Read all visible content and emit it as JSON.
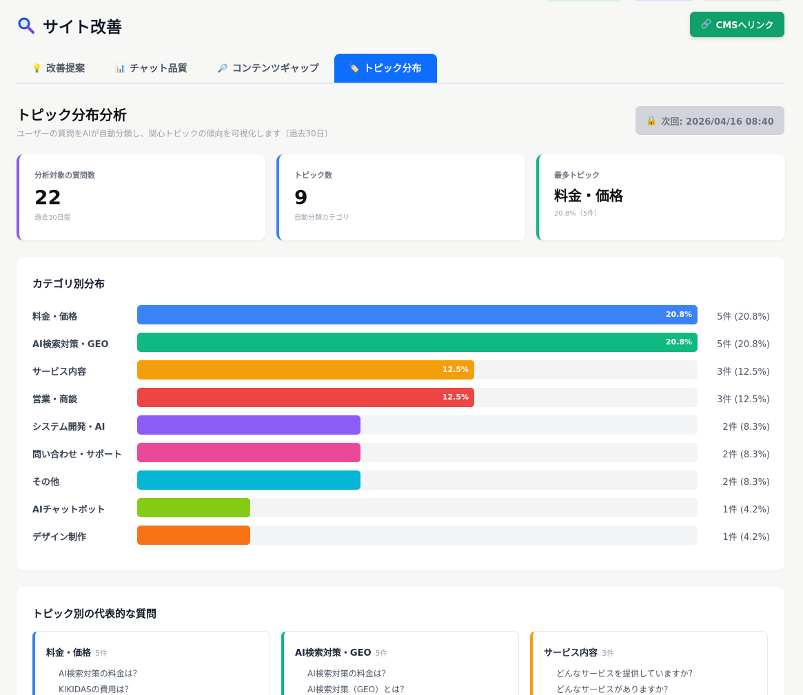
{
  "header": {
    "title": "サイト改善",
    "cms_button": "CMSへリンク"
  },
  "tabs": [
    {
      "icon": "💡",
      "label": "改善提案"
    },
    {
      "icon": "📊",
      "label": "チャット品質"
    },
    {
      "icon": "🔎",
      "label": "コンテンツギャップ"
    },
    {
      "icon": "🏷️",
      "label": "トピック分布"
    }
  ],
  "section": {
    "title": "トピック分布分析",
    "subtitle": "ユーザーの質問をAIが自動分類し、関心トピックの傾向を可視化します（過去30日）",
    "next_run": "次回: 2026/04/16 08:40"
  },
  "stats": [
    {
      "label": "分析対象の質問数",
      "value": "22",
      "note": "過去30日間"
    },
    {
      "label": "トピック数",
      "value": "9",
      "note": "自動分類カテゴリ"
    },
    {
      "label": "最多トピック",
      "value": "料金・価格",
      "note": "20.8%（5件）"
    }
  ],
  "chart_data": {
    "type": "bar",
    "title": "カテゴリ別分布",
    "categories": [
      "料金・価格",
      "AI検索対策・GEO",
      "サービス内容",
      "営業・商談",
      "システム開発・AI",
      "問い合わせ・サポート",
      "その他",
      "AIチャットボット",
      "デザイン制作"
    ],
    "values": [
      20.8,
      20.8,
      12.5,
      12.5,
      8.3,
      8.3,
      8.3,
      4.2,
      4.2
    ],
    "counts": [
      "5件 (20.8%)",
      "5件 (20.8%)",
      "3件 (12.5%)",
      "3件 (12.5%)",
      "2件 (8.3%)",
      "2件 (8.3%)",
      "2件 (8.3%)",
      "1件 (4.2%)",
      "1件 (4.2%)"
    ],
    "inner_labels": [
      "20.8%",
      "20.8%",
      "12.5%",
      "12.5%",
      "",
      "",
      "",
      "",
      ""
    ],
    "colors": [
      "#3b82f6",
      "#10b981",
      "#f59e0b",
      "#ef4444",
      "#8b5cf6",
      "#ec4899",
      "#06b6d4",
      "#84cc16",
      "#f97316"
    ],
    "xlim": [
      0,
      20.8
    ]
  },
  "representative": {
    "title": "トピック別の代表的な質問",
    "topics": [
      {
        "name": "料金・価格",
        "count": "5件",
        "questions": [
          "AI検索対策の料金は？",
          "KIKIDASの費用は？"
        ]
      },
      {
        "name": "AI検索対策・GEO",
        "count": "5件",
        "questions": [
          "AI検索対策の料金は？",
          "AI検索対策（GEO）とは？"
        ]
      },
      {
        "name": "サービス内容",
        "count": "3件",
        "questions": [
          "どんなサービスを提供していますか？",
          "どんなサービスがありますか？"
        ]
      }
    ]
  }
}
